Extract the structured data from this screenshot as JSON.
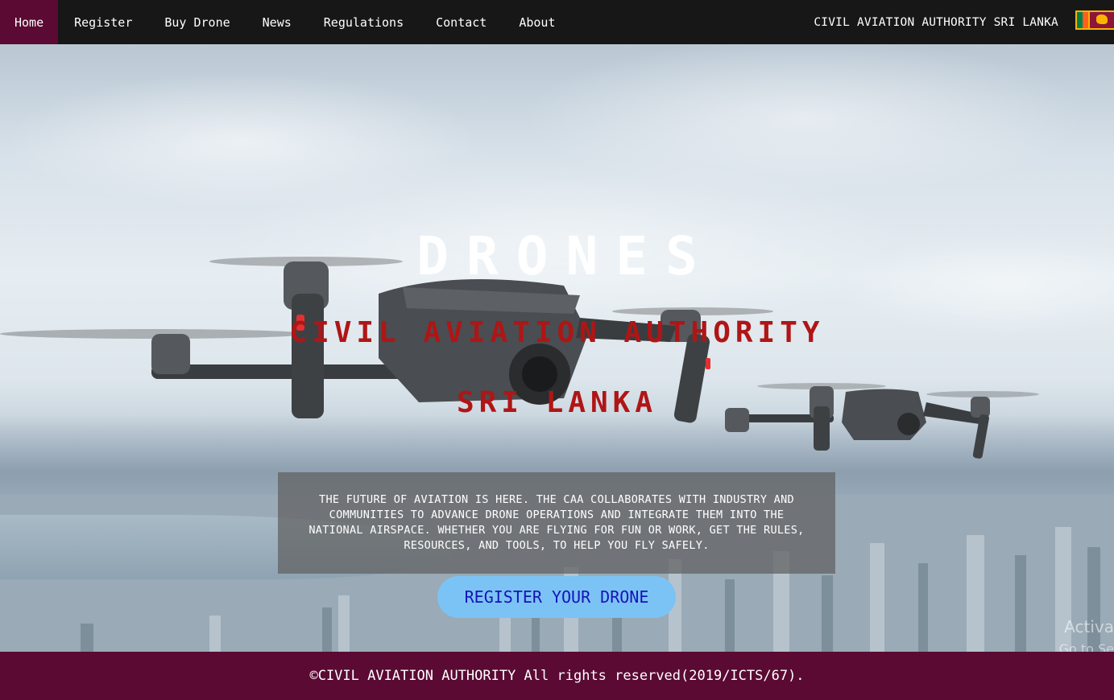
{
  "nav": {
    "items": [
      {
        "label": "Home",
        "active": true
      },
      {
        "label": "Register"
      },
      {
        "label": "Buy Drone"
      },
      {
        "label": "News"
      },
      {
        "label": "Regulations"
      },
      {
        "label": "Contact"
      },
      {
        "label": "About"
      }
    ],
    "brand": "CIVIL AVIATION AUTHORITY SRI LANKA",
    "flag_icon": "sri-lanka-flag-icon"
  },
  "hero": {
    "title": "DRONES",
    "subtitle_line1": "CIVIL AVIATION AUTHORITY",
    "subtitle_line2": "SRI LANKA",
    "description": "THE FUTURE OF AVIATION IS HERE. THE CAA COLLABORATES WITH INDUSTRY AND COMMUNITIES TO ADVANCE DRONE OPERATIONS AND INTEGRATE THEM INTO THE NATIONAL AIRSPACE. WHETHER YOU ARE FLYING FOR FUN OR WORK, GET THE RULES, RESOURCES, AND TOOLS, TO HELP YOU FLY SAFELY.",
    "cta_label": "REGISTER YOUR DRONE"
  },
  "footer": {
    "text": "©CIVIL AVIATION AUTHORITY All rights reserved(2019/ICTS/67)."
  },
  "os_watermark": {
    "line1": "Activa",
    "line2": "Go to Se"
  },
  "colors": {
    "nav_bg": "#171717",
    "accent": "#5a0a33",
    "subtitle": "#b01515",
    "cta_bg": "#7cc3f5",
    "cta_text": "#1414b8"
  }
}
